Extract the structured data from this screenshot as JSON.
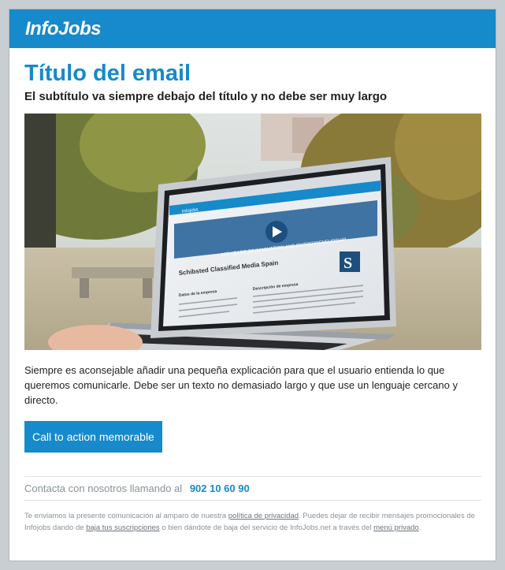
{
  "header": {
    "logo": "InfoJobs"
  },
  "email": {
    "title": "Título del email",
    "subtitle": "El subtítulo va siempre debajo del título y no debe ser muy largo",
    "body": "Siempre es aconsejable añadir una pequeña explicación para que el usuario entienda lo que queremos comunicarle. Debe ser un texto no demasiado largo y que use un lenguaje cercano y directo.",
    "cta_label": "Call to action memorable"
  },
  "hero": {
    "screen_brand": "Infojobs",
    "banner_text": "175 YEARS OF INNOVATION AND ENTREPRENEURSHIP",
    "company": "Schibsted Classified Media Spain",
    "details_heading": "Datos de la empresa",
    "description_heading": "Descripción de empresa"
  },
  "contact": {
    "label": "Contacta con nosotros llamando al",
    "phone": "902 10 60 90"
  },
  "legal": {
    "part1": "Te enviamos la presente comunicación al amparo de nuestra ",
    "link_privacy": "política de privacidad",
    "part2": ". Puedes dejar de recibir mensajes promocionales de Infojobs dando de ",
    "link_unsubscribe": "baja tus suscripciones",
    "part3": " o bien dándote de baja del servicio de InfoJobs.net a través del ",
    "link_private_menu": "menú privado",
    "part4": "."
  },
  "colors": {
    "brand": "#168acb",
    "background": "#c9ced3"
  }
}
